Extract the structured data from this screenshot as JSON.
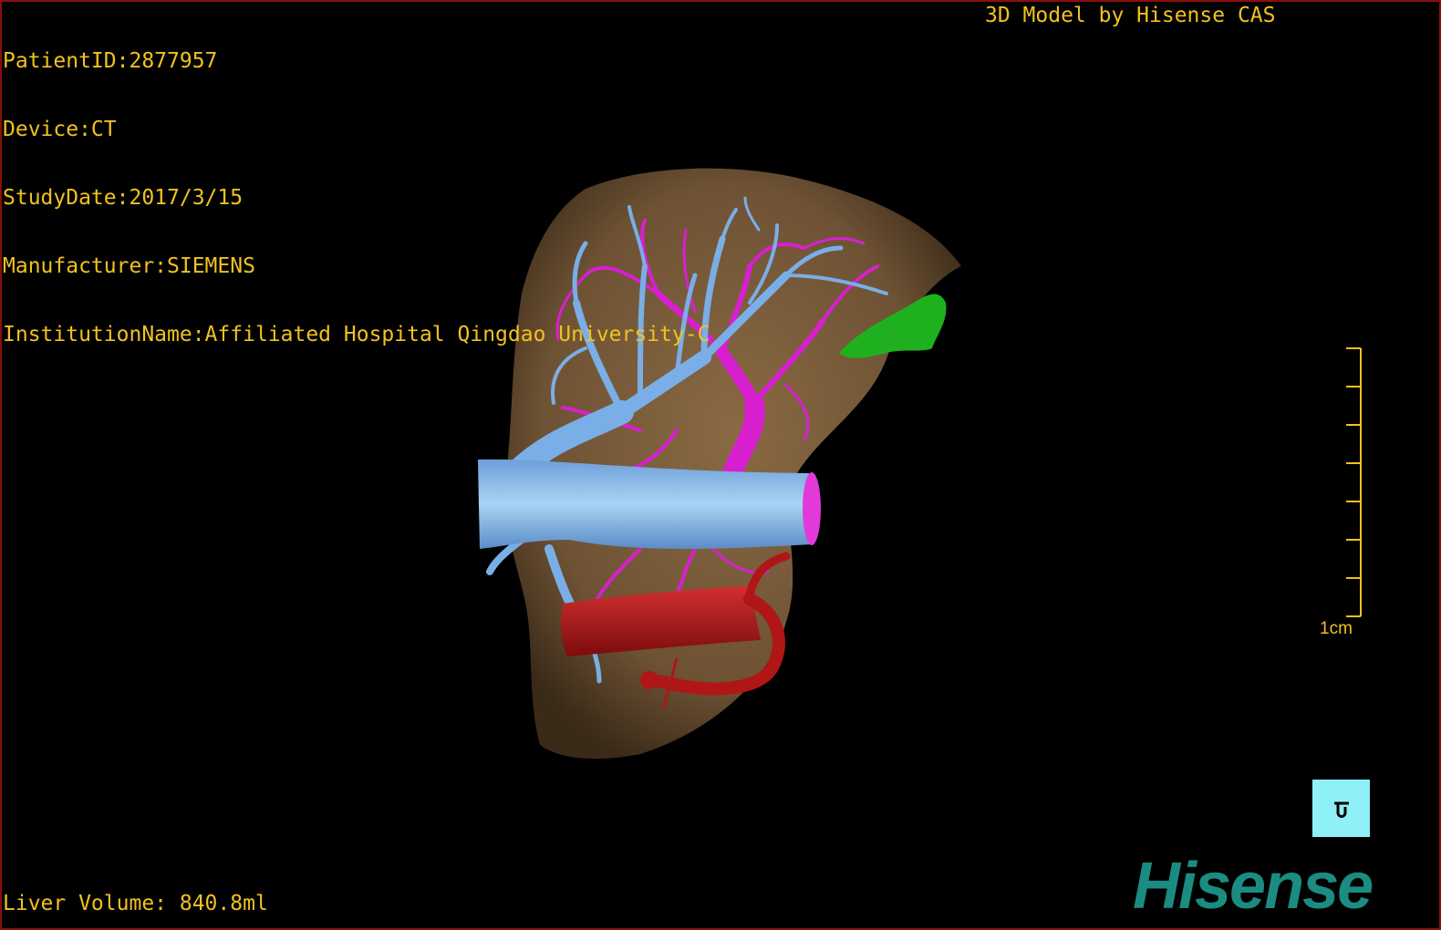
{
  "study_info": {
    "patient_id": "PatientID:2877957",
    "device": "Device:CT",
    "study_date": "StudyDate:2017/3/15",
    "manufacturer": "Manufacturer:SIEMENS",
    "institution": "InstitutionName:Affiliated Hospital Qingdao University-C"
  },
  "credit": "3D Model by Hisense CAS",
  "measurements": {
    "liver_volume": "Liver Volume: 840.8ml"
  },
  "scale_bar": {
    "label": "1cm"
  },
  "orientation_widget": {
    "icon": "orientation-cube-icon"
  },
  "brand": {
    "logo_text": "Hisense"
  },
  "colors": {
    "overlay_text": "#f0c21f",
    "liver": "#7a5c3a",
    "hepatic_vein": "#7aaee6",
    "portal_vein": "#d81fd0",
    "artery": "#b01616",
    "gallbladder": "#1fb01f",
    "orientation_bg": "#8ff0f7",
    "brand": "#1b8c82",
    "border": "#8a0f0f"
  }
}
